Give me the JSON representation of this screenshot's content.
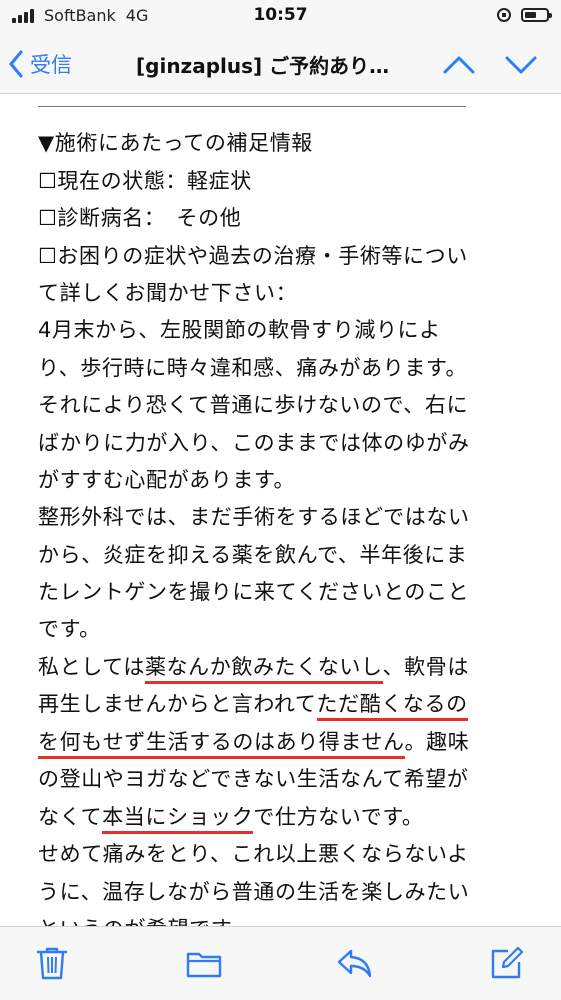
{
  "status_bar": {
    "carrier": "SoftBank",
    "network": "4G",
    "time": "10:57",
    "battery_level": 0.55
  },
  "nav": {
    "back_label": "受信",
    "title": "[ginzaplus] ご予約あり…"
  },
  "body": {
    "lines": [
      "▼施術にあたっての補足情報",
      "☐現在の状態：軽症状",
      "☐診断病名：　その他",
      "☐お困りの症状や過去の治療・手術等につい",
      "て詳しくお聞かせ下さい：",
      "4月末から、左股関節の軟骨すり減りによ",
      "り、歩行時に時々違和感、痛みがあります。",
      "それにより恐くて普通に歩けないので、右に",
      "ばかりに力が入り、このままでは体のゆがみ",
      "がすすむ心配があります。",
      "整形外科では、まだ手術をするほどではない",
      "から、炎症を抑える薬を飲んで、半年後にま",
      "たレントゲンを撮りに来てくださいとのこと",
      "です。"
    ],
    "line_p1_a": "私としては",
    "line_p1_u": "薬なんか飲みたくないし",
    "line_p1_b": "、軟骨は",
    "line_p2_a": "再生しませんからと言われて",
    "line_p2_u": "ただ酷くなるの",
    "line_p3_u": "を何もせず生活するのはあり得ません",
    "line_p3_b": "。趣味",
    "line_p4": "の登山やヨガなどできない生活なんて希望が",
    "line_p5_a": "なくて",
    "line_p5_u": "本当にショック",
    "line_p5_b": "で仕方ないです。",
    "line_p6": "せめて痛みをとり、これ以上悪くならないよ",
    "line_p7": "うに、温存しながら普通の生活を楽しみたい",
    "line_p8": "というのが希望です。"
  },
  "colors": {
    "accent": "#2f7cf6",
    "underline": "#e5312b"
  },
  "icons": {
    "back": "chevron-left-icon",
    "up": "chevron-up-icon",
    "down": "chevron-down-icon",
    "trash": "trash-icon",
    "folder": "folder-icon",
    "reply": "reply-icon",
    "compose": "compose-icon"
  }
}
